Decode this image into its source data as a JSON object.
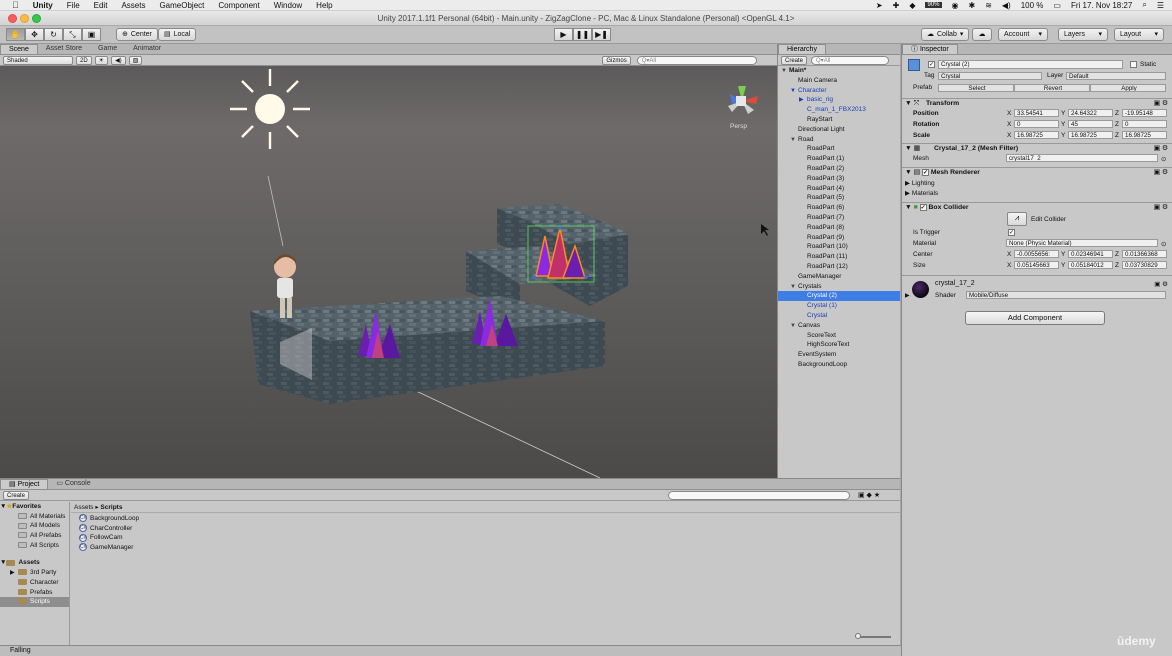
{
  "menubar": {
    "apple": "",
    "app": "Unity",
    "items": [
      "File",
      "Edit",
      "Assets",
      "GameObject",
      "Component",
      "Window",
      "Help"
    ],
    "battery": "100 %",
    "clock": "Fri 17. Nov 18:27",
    "mem": "90%"
  },
  "window": {
    "title": "Unity 2017.1.1f1 Personal (64bit) - Main.unity - ZigZagClone - PC, Mac & Linux Standalone (Personal) <OpenGL 4.1>"
  },
  "toolbar": {
    "center": "Center",
    "local": "Local",
    "collab": "Collab",
    "account": "Account",
    "layers": "Layers",
    "layout": "Layout"
  },
  "scene": {
    "tabs": [
      "Scene",
      "Asset Store",
      "Game",
      "Animator"
    ],
    "shading": "Shaded",
    "mode2d": "2D",
    "gizmos": "Gizmos",
    "search_placeholder": "Q▾All",
    "persp": "Persp"
  },
  "hierarchy": {
    "title": "Hierarchy",
    "create": "Create",
    "search_placeholder": "Q▾All",
    "rows": [
      {
        "label": "Main*",
        "indent": 0,
        "arrow": "▼",
        "bold": true
      },
      {
        "label": "Main Camera",
        "indent": 1
      },
      {
        "label": "Character",
        "indent": 1,
        "arrow": "▼",
        "blue": true
      },
      {
        "label": "basic_rig",
        "indent": 2,
        "arrow": "▶",
        "blue": true
      },
      {
        "label": "C_man_1_FBX2013",
        "indent": 2,
        "blue": true
      },
      {
        "label": "RayStart",
        "indent": 2
      },
      {
        "label": "Directional Light",
        "indent": 1
      },
      {
        "label": "Road",
        "indent": 1,
        "arrow": "▼"
      },
      {
        "label": "RoadPart",
        "indent": 2
      },
      {
        "label": "RoadPart (1)",
        "indent": 2
      },
      {
        "label": "RoadPart (2)",
        "indent": 2
      },
      {
        "label": "RoadPart (3)",
        "indent": 2
      },
      {
        "label": "RoadPart (4)",
        "indent": 2
      },
      {
        "label": "RoadPart (5)",
        "indent": 2
      },
      {
        "label": "RoadPart (6)",
        "indent": 2
      },
      {
        "label": "RoadPart (7)",
        "indent": 2
      },
      {
        "label": "RoadPart (8)",
        "indent": 2
      },
      {
        "label": "RoadPart (9)",
        "indent": 2
      },
      {
        "label": "RoadPart (10)",
        "indent": 2
      },
      {
        "label": "RoadPart (11)",
        "indent": 2
      },
      {
        "label": "RoadPart (12)",
        "indent": 2
      },
      {
        "label": "GameManager",
        "indent": 1
      },
      {
        "label": "Crystals",
        "indent": 1,
        "arrow": "▼"
      },
      {
        "label": "Crystal (2)",
        "indent": 2,
        "selected": true
      },
      {
        "label": "Crystal (1)",
        "indent": 2,
        "blue": true
      },
      {
        "label": "Crystal",
        "indent": 2,
        "blue": true
      },
      {
        "label": "Canvas",
        "indent": 1,
        "arrow": "▼"
      },
      {
        "label": "ScoreText",
        "indent": 2
      },
      {
        "label": "HighScoreText",
        "indent": 2
      },
      {
        "label": "EventSystem",
        "indent": 1
      },
      {
        "label": "BackgroundLoop",
        "indent": 1
      }
    ]
  },
  "inspector": {
    "title": "Inspector",
    "name": "Crystal (2)",
    "static": "Static",
    "tag_label": "Tag",
    "tag": "Crystal",
    "layer_label": "Layer",
    "layer": "Default",
    "prefab_label": "Prefab",
    "prefab_buttons": [
      "Select",
      "Revert",
      "Apply"
    ],
    "transform": {
      "title": "Transform",
      "rows": [
        {
          "label": "Position",
          "x": "33.54541",
          "y": "24.64322",
          "z": "-19.95148"
        },
        {
          "label": "Rotation",
          "x": "0",
          "y": "45",
          "z": "0"
        },
        {
          "label": "Scale",
          "x": "16.98725",
          "y": "16.98725",
          "z": "16.98725"
        }
      ]
    },
    "mesh_filter": {
      "title": "Crystal_17_2 (Mesh Filter)",
      "mesh_label": "Mesh",
      "mesh": "crystal17_2"
    },
    "mesh_renderer": {
      "title": "Mesh Renderer",
      "lighting": "Lighting",
      "materials": "Materials"
    },
    "box_collider": {
      "title": "Box Collider",
      "edit": "Edit Collider",
      "is_trigger": "Is Trigger",
      "material_label": "Material",
      "material": "None (Physic Material)",
      "center_label": "Center",
      "center": {
        "x": "-0.0055656:",
        "y": "0.02346941",
        "z": "0.01366368"
      },
      "size_label": "Size",
      "size": {
        "x": "0.05145663",
        "y": "0.05184012",
        "z": "0.03730829"
      }
    },
    "material": {
      "name": "crystal_17_2",
      "shader_label": "Shader",
      "shader": "Mobile/Diffuse"
    },
    "add_component": "Add Component"
  },
  "project": {
    "tabs": [
      "Project",
      "Console"
    ],
    "create": "Create",
    "breadcrumb": [
      "Assets",
      "Scripts"
    ],
    "favorites": {
      "title": "Favorites",
      "items": [
        "All Materials",
        "All Models",
        "All Prefabs",
        "All Scripts"
      ]
    },
    "assets": {
      "title": "Assets",
      "items": [
        "3rd Party",
        "Character",
        "Prefabs",
        "Scripts"
      ],
      "selected": "Scripts"
    },
    "files": [
      "BackgroundLoop",
      "CharController",
      "FollowCam",
      "GameManager"
    ]
  },
  "status": {
    "text": "Falling"
  },
  "watermark": "ūdemy"
}
